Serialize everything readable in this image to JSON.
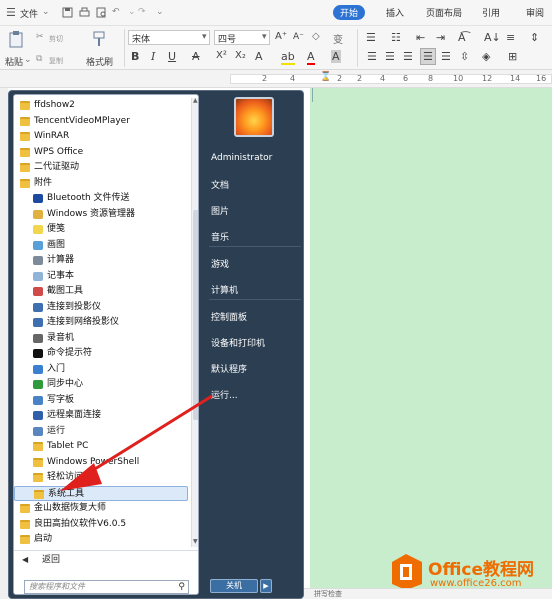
{
  "menubar": {
    "file_label": "文件",
    "tabs": [
      {
        "label": "开始",
        "active": true
      },
      {
        "label": "插入",
        "active": false
      },
      {
        "label": "页面布局",
        "active": false
      },
      {
        "label": "引用",
        "active": false
      },
      {
        "label": "审阅",
        "active": false
      }
    ]
  },
  "ribbon": {
    "paste_label": "粘贴",
    "cut_label": "剪切",
    "copy_label": "复制",
    "format_painter_label": "格式刷",
    "font_name": "宋体",
    "font_size": "四号"
  },
  "ruler": {
    "marks": [
      "2",
      "4",
      "2",
      "2",
      "4",
      "6",
      "8",
      "10",
      "12",
      "14",
      "16"
    ]
  },
  "startmenu": {
    "programs": [
      {
        "label": "ffdshow2",
        "type": "folder",
        "level": 0
      },
      {
        "label": "TencentVideoMPlayer",
        "type": "folder",
        "level": 0
      },
      {
        "label": "WinRAR",
        "type": "folder",
        "level": 0
      },
      {
        "label": "WPS Office",
        "type": "folder",
        "level": 0
      },
      {
        "label": "二代证驱动",
        "type": "folder",
        "level": 0
      },
      {
        "label": "附件",
        "type": "folder",
        "level": 0
      },
      {
        "label": "Bluetooth 文件传送",
        "type": "bluetooth",
        "level": 1
      },
      {
        "label": "Windows 资源管理器",
        "type": "explorer",
        "level": 1
      },
      {
        "label": "便笺",
        "type": "notes",
        "level": 1
      },
      {
        "label": "画图",
        "type": "paint",
        "level": 1
      },
      {
        "label": "计算器",
        "type": "calc",
        "level": 1
      },
      {
        "label": "记事本",
        "type": "notepad",
        "level": 1
      },
      {
        "label": "截图工具",
        "type": "snip",
        "level": 1
      },
      {
        "label": "连接到投影仪",
        "type": "projector",
        "level": 1
      },
      {
        "label": "连接到网络投影仪",
        "type": "netprojector",
        "level": 1
      },
      {
        "label": "录音机",
        "type": "recorder",
        "level": 1
      },
      {
        "label": "命令提示符",
        "type": "cmd",
        "level": 1
      },
      {
        "label": "入门",
        "type": "start",
        "level": 1
      },
      {
        "label": "同步中心",
        "type": "sync",
        "level": 1
      },
      {
        "label": "写字板",
        "type": "wordpad",
        "level": 1
      },
      {
        "label": "远程桌面连接",
        "type": "rdp",
        "level": 1
      },
      {
        "label": "运行",
        "type": "run",
        "level": 1
      },
      {
        "label": "Tablet PC",
        "type": "folder",
        "level": 1
      },
      {
        "label": "Windows PowerShell",
        "type": "folder",
        "level": 1
      },
      {
        "label": "轻松访问",
        "type": "folder",
        "level": 1
      },
      {
        "label": "系统工具",
        "type": "folder",
        "level": 1,
        "selected": true
      },
      {
        "label": "金山数据恢复大师",
        "type": "folder",
        "level": 0
      },
      {
        "label": "良田高拍仪软件V6.0.5",
        "type": "folder",
        "level": 0
      },
      {
        "label": "启动",
        "type": "folder",
        "level": 0
      }
    ],
    "back_label": "返回",
    "search_placeholder": "搜索程序和文件",
    "right_items": [
      {
        "label": "Administrator"
      },
      {
        "label": "文档"
      },
      {
        "label": "图片"
      },
      {
        "label": "音乐"
      },
      {
        "label": "游戏"
      },
      {
        "label": "计算机"
      },
      {
        "label": "控制面板"
      },
      {
        "label": "设备和打印机"
      },
      {
        "label": "默认程序"
      },
      {
        "label": "运行..."
      }
    ],
    "shutdown_label": "关机"
  },
  "watermark": {
    "brand": "Office教程网",
    "url": "www.office26.com"
  },
  "statusbar": {
    "text": "拼写检查"
  },
  "colors": {
    "accent": "#2d73d3",
    "doc_background": "#c7edcc",
    "startmenu_bg": "#2b3e52",
    "arrow": "#e0201c",
    "watermark_orange": "#ef6c00"
  }
}
